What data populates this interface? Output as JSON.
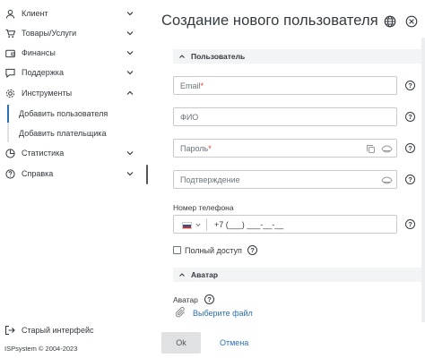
{
  "sidebar": {
    "items": [
      {
        "label": "Клиент",
        "icon": "user-icon",
        "expanded": false
      },
      {
        "label": "Товары/Услуги",
        "icon": "cart-icon",
        "expanded": false
      },
      {
        "label": "Финансы",
        "icon": "wallet-icon",
        "expanded": false
      },
      {
        "label": "Поддержка",
        "icon": "chat-icon",
        "expanded": false
      },
      {
        "label": "Инструменты",
        "icon": "gear-icon",
        "expanded": true
      },
      {
        "label": "Статистика",
        "icon": "chart-icon",
        "expanded": false
      },
      {
        "label": "Справка",
        "icon": "help-circle-icon",
        "expanded": false
      }
    ],
    "sub_items": [
      {
        "label": "Добавить пользователя",
        "active": true
      },
      {
        "label": "Добавить плательщика",
        "active": false
      }
    ],
    "old_interface": "Старый интерфейс",
    "copyright": "ISPsystem © 2004-2023"
  },
  "page": {
    "title": "Создание нового пользователя"
  },
  "sections": {
    "user": "Пользователь",
    "avatar": "Аватар"
  },
  "form": {
    "email_placeholder": "Email",
    "fio_placeholder": "ФИО",
    "password_placeholder": "Пароль",
    "confirm_placeholder": "Подтверждение",
    "required_mark": "*",
    "phone_label": "Номер телефона",
    "phone_value": "+7 (___) ___-__-__",
    "full_access_label": "Полный доступ",
    "full_access_checked": false,
    "avatar_label": "Аватар",
    "choose_file": "Выберите файл",
    "help_glyph": "?"
  },
  "footer": {
    "ok": "Ok",
    "cancel": "Отмена"
  },
  "colors": {
    "accent": "#2d6fb7",
    "required": "#e53935",
    "section_bg": "#f3f4f5"
  }
}
